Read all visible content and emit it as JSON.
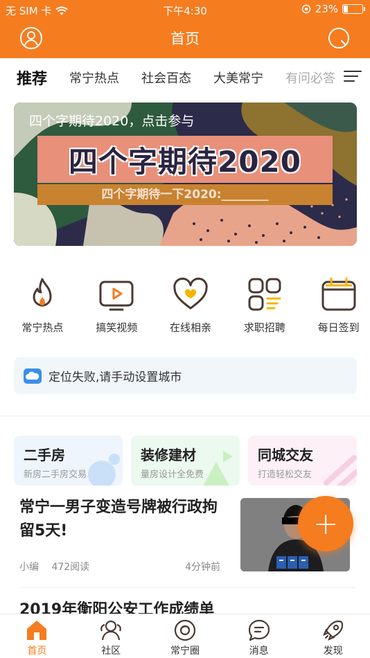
{
  "status_bar": {
    "carrier": "无 SIM 卡",
    "time": "下午4:30",
    "battery": "23%",
    "battery_level": 0.23
  },
  "header": {
    "title": "首页"
  },
  "tabs": [
    {
      "label": "推荐",
      "active": true
    },
    {
      "label": "常宁热点"
    },
    {
      "label": "社会百态"
    },
    {
      "label": "大美常宁"
    },
    {
      "label": "有问必答"
    }
  ],
  "banner": {
    "caption": "四个字期待2020，点击参与",
    "big_text": "四个字期待2020",
    "sub_text": "四个字期待一下2020:________"
  },
  "features": [
    {
      "label": "常宁热点",
      "icon": "flame-icon"
    },
    {
      "label": "搞笑视频",
      "icon": "video-play-icon"
    },
    {
      "label": "在线相亲",
      "icon": "heart-icon"
    },
    {
      "label": "求职招聘",
      "icon": "grid-list-icon"
    },
    {
      "label": "每日签到",
      "icon": "calendar-icon"
    }
  ],
  "notice": {
    "text": "定位失败,请手动设置城市",
    "icon": "cloud-icon"
  },
  "cards": [
    {
      "title": "二手房",
      "subtitle": "新房二手房交易"
    },
    {
      "title": "装修建材",
      "subtitle": "量房设计全免费"
    },
    {
      "title": "同城交友",
      "subtitle": "打造轻松交友"
    }
  ],
  "news": [
    {
      "headline": "常宁一男子变造号牌被行政拘留5天!",
      "author": "小编",
      "reads": "472阅读",
      "time": "4分钟前"
    },
    {
      "headline": "2019年衡阳公安工作成绩单"
    }
  ],
  "fab": {
    "label": "+"
  },
  "bottom_nav": [
    {
      "label": "首页",
      "active": true
    },
    {
      "label": "社区"
    },
    {
      "label": "常宁圈"
    },
    {
      "label": "消息"
    },
    {
      "label": "发现"
    }
  ],
  "colors": {
    "brand": "#f57c1f",
    "icon_dark": "#4a3a33",
    "accent_yellow": "#f5b400"
  }
}
